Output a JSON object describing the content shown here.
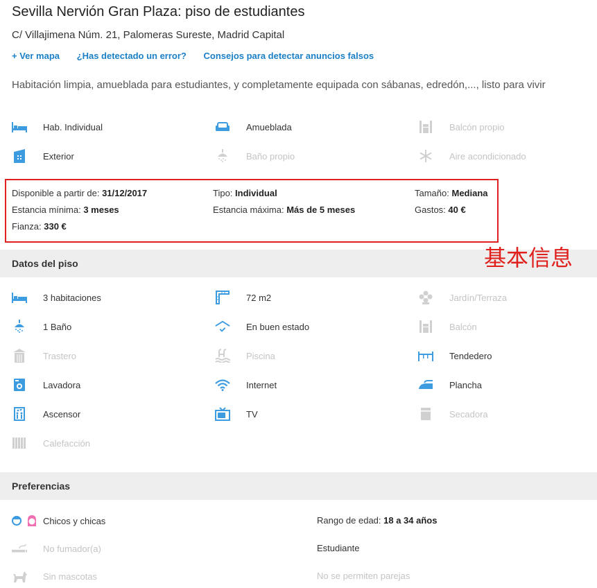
{
  "header": {
    "title": "Sevilla Nervión Gran Plaza: piso de estudiantes",
    "address": "C/ Villajimena Núm. 21, Palomeras Sureste, Madrid Capital",
    "links": [
      "+ Ver mapa",
      "¿Has detectado un error?",
      "Consejos para detectar anuncios falsos"
    ],
    "description": "Habitación limpia, amueblada para estudiantes, y completamente equipada con sábanas, edredón,..., listo para vivir"
  },
  "room_features": [
    {
      "label": "Hab. Individual",
      "icon": "bed-icon",
      "enabled": true
    },
    {
      "label": "Amueblada",
      "icon": "sofa-icon",
      "enabled": true
    },
    {
      "label": "Balcón propio",
      "icon": "balcony-icon",
      "enabled": false
    },
    {
      "label": "Exterior",
      "icon": "building-icon",
      "enabled": true
    },
    {
      "label": "Baño propio",
      "icon": "shower-icon",
      "enabled": false
    },
    {
      "label": "Aire acondicionado",
      "icon": "snowflake-icon",
      "enabled": false
    }
  ],
  "basic_info": {
    "disponible_label": "Disponible a partir de: ",
    "disponible_value": "31/12/2017",
    "tipo_label": "Tipo: ",
    "tipo_value": "Individual",
    "tamano_label": "Tamaño: ",
    "tamano_value": "Mediana",
    "estancia_min_label": "Estancia mínima: ",
    "estancia_min_value": "3 meses",
    "estancia_max_label": "Estancia máxima: ",
    "estancia_max_value": "Más de 5 meses",
    "gastos_label": "Gastos: ",
    "gastos_value": "40 €",
    "fianza_label": "Fianza: ",
    "fianza_value": "330 €"
  },
  "annotation": "基本信息",
  "datos_piso": {
    "title": "Datos del piso",
    "items": [
      {
        "label": "3 habitaciones",
        "icon": "bed-icon",
        "enabled": true
      },
      {
        "label": "72 m2",
        "icon": "ruler-icon",
        "enabled": true
      },
      {
        "label": "Jardín/Terraza",
        "icon": "flower-icon",
        "enabled": false
      },
      {
        "label": "1 Baño",
        "icon": "shower-icon",
        "enabled": true
      },
      {
        "label": "En buen estado",
        "icon": "roof-check-icon",
        "enabled": true
      },
      {
        "label": "Balcón",
        "icon": "balcony-icon",
        "enabled": false
      },
      {
        "label": "Trastero",
        "icon": "storage-icon",
        "enabled": false
      },
      {
        "label": "Piscina",
        "icon": "pool-icon",
        "enabled": false
      },
      {
        "label": "Tendedero",
        "icon": "clothesline-icon",
        "enabled": true
      },
      {
        "label": "Lavadora",
        "icon": "washer-icon",
        "enabled": true
      },
      {
        "label": "Internet",
        "icon": "wifi-icon",
        "enabled": true
      },
      {
        "label": "Plancha",
        "icon": "iron-icon",
        "enabled": true
      },
      {
        "label": "Ascensor",
        "icon": "elevator-icon",
        "enabled": true
      },
      {
        "label": "TV",
        "icon": "tv-icon",
        "enabled": true
      },
      {
        "label": "Secadora",
        "icon": "dryer-icon",
        "enabled": false
      },
      {
        "label": "Calefacción",
        "icon": "radiator-icon",
        "enabled": false
      }
    ]
  },
  "preferencias": {
    "title": "Preferencias",
    "gender": "Chicos y chicas",
    "age_label": "Rango de edad: ",
    "age_value": "18 a 34 años",
    "smoker": "No fumador(a)",
    "occupation": "Estudiante",
    "pets": "Sin mascotas",
    "couples": "No se permiten parejas"
  },
  "colors": {
    "icon_active": "#3d9be0",
    "icon_inactive": "#d0d0d0",
    "link": "#1a7fc6",
    "highlight": "#e02020",
    "section_bg": "#eeeeee"
  }
}
